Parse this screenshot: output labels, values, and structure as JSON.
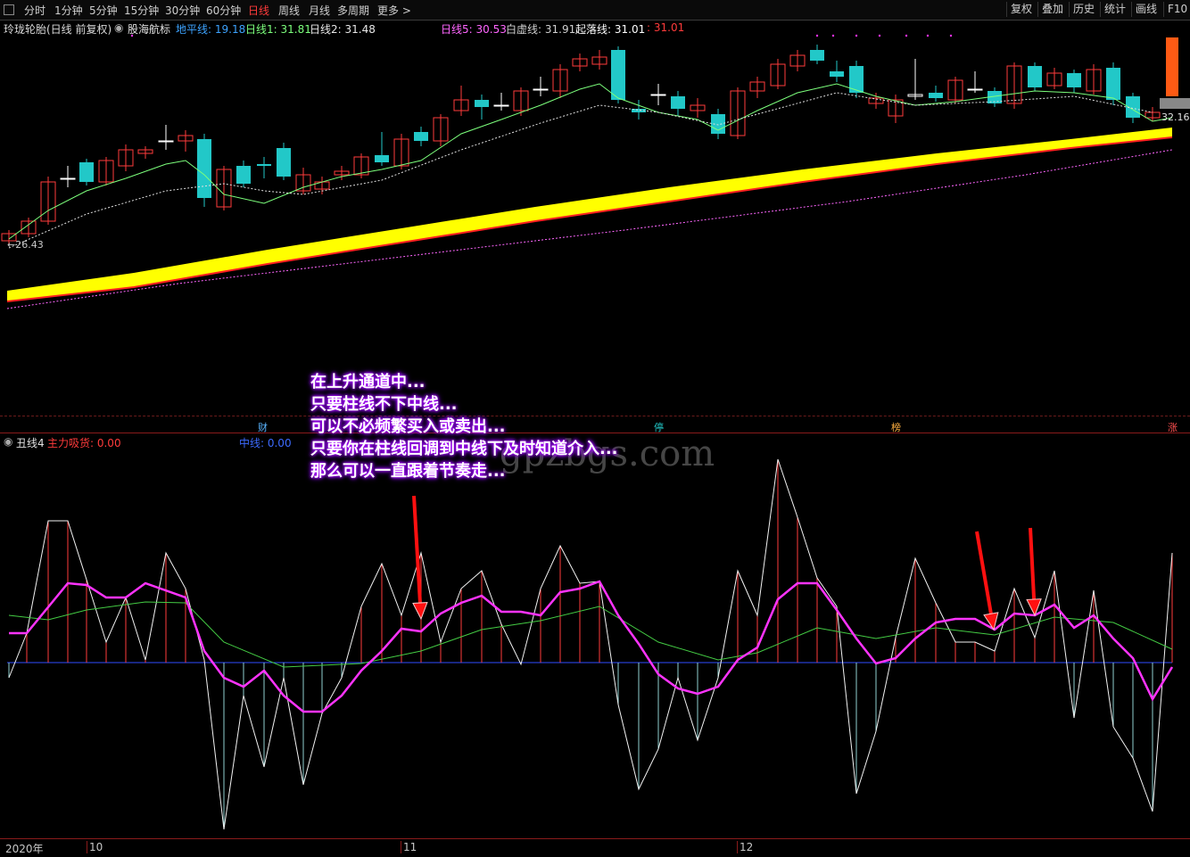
{
  "toolbar": {
    "periods": [
      "分时",
      "1分钟",
      "5分钟",
      "15分钟",
      "30分钟",
      "60分钟",
      "日线",
      "周线",
      "月线",
      "多周期",
      "更多 >"
    ],
    "active_period": "日线",
    "right_buttons": [
      "复权",
      "叠加",
      "历史",
      "统计",
      "画线",
      "F10"
    ]
  },
  "info_main": {
    "stock": "玲珑轮胎(日线 前复权)",
    "indicator": "股海航标",
    "items": [
      {
        "label": "地平线: 19.18",
        "color": "#3da3ff"
      },
      {
        "label": "日线1: 31.81",
        "color": "#7cff7c"
      },
      {
        "label": "日线2: 31.48",
        "color": "#e8e8e8"
      },
      {
        "label": "日线5: 30.53",
        "color": "#ff66ff"
      },
      {
        "label": "白虚线: 31.91",
        "color": "#d0d0d0"
      },
      {
        "label": "起落线: 31.01",
        "color": "#ffffff"
      },
      {
        "label": ": 31.01",
        "color": "#ff3b3b"
      }
    ]
  },
  "price_labels": {
    "low": "26.43",
    "last": "32.16"
  },
  "event_markers": [
    "财",
    "停",
    "榜",
    "涨"
  ],
  "info_sub": {
    "indicator": "丑线4",
    "items": [
      {
        "label": "主力吸货: 0.00",
        "color": "#ff3b3b"
      },
      {
        "label": "中线: 0.00",
        "color": "#3d6bff"
      }
    ]
  },
  "annotation": [
    "在上升通道中...",
    "只要柱线不下中线...",
    "可以不必频繁买入或卖出...",
    "只要你在柱线回调到中线下及时知道介入...",
    "那么可以一直跟着节奏走..."
  ],
  "watermark": "gpzbgs.com",
  "date_axis": [
    "2020年",
    "10",
    "11",
    "12"
  ],
  "colors": {
    "up": "#ff3b3b",
    "down": "#22c8c8",
    "band": "#ffff00",
    "ma": "#7cff7c",
    "oscillator": "#ff33ff"
  }
}
